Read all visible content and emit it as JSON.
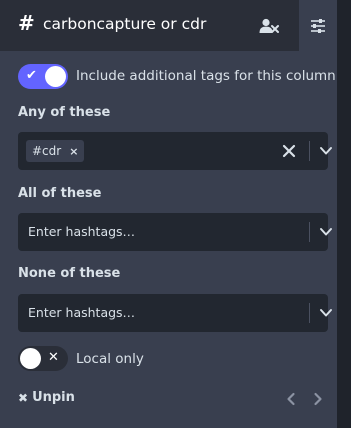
{
  "header": {
    "hash_symbol": "#",
    "title": "carboncapture or cdr",
    "remove_icon": "user-remove-icon",
    "settings_icon": "sliders-icon"
  },
  "include_toggle": {
    "state": "on",
    "glyph": "✔",
    "label": "Include additional tags for this column"
  },
  "any_of": {
    "title": "Any of these",
    "tags": [
      {
        "label": "#cdr",
        "remove": "×"
      }
    ],
    "clear_icon": "x-icon",
    "dropdown_icon": "chevron-down-icon"
  },
  "all_of": {
    "title": "All of these",
    "placeholder": "Enter hashtags…",
    "dropdown_icon": "chevron-down-icon"
  },
  "none_of": {
    "title": "None of these",
    "placeholder": "Enter hashtags…",
    "dropdown_icon": "chevron-down-icon"
  },
  "local_only": {
    "state": "off",
    "glyph": "✕",
    "label": "Local only"
  },
  "footer": {
    "unpin_glyph": "✖",
    "unpin_label": "Unpin",
    "prev_icon": "chevron-left-icon",
    "next_icon": "chevron-right-icon"
  },
  "colors": {
    "accent": "#6364ff",
    "panel": "#393f4f",
    "header": "#2a2e38",
    "input": "#222730",
    "text": "#d9e1e8"
  }
}
